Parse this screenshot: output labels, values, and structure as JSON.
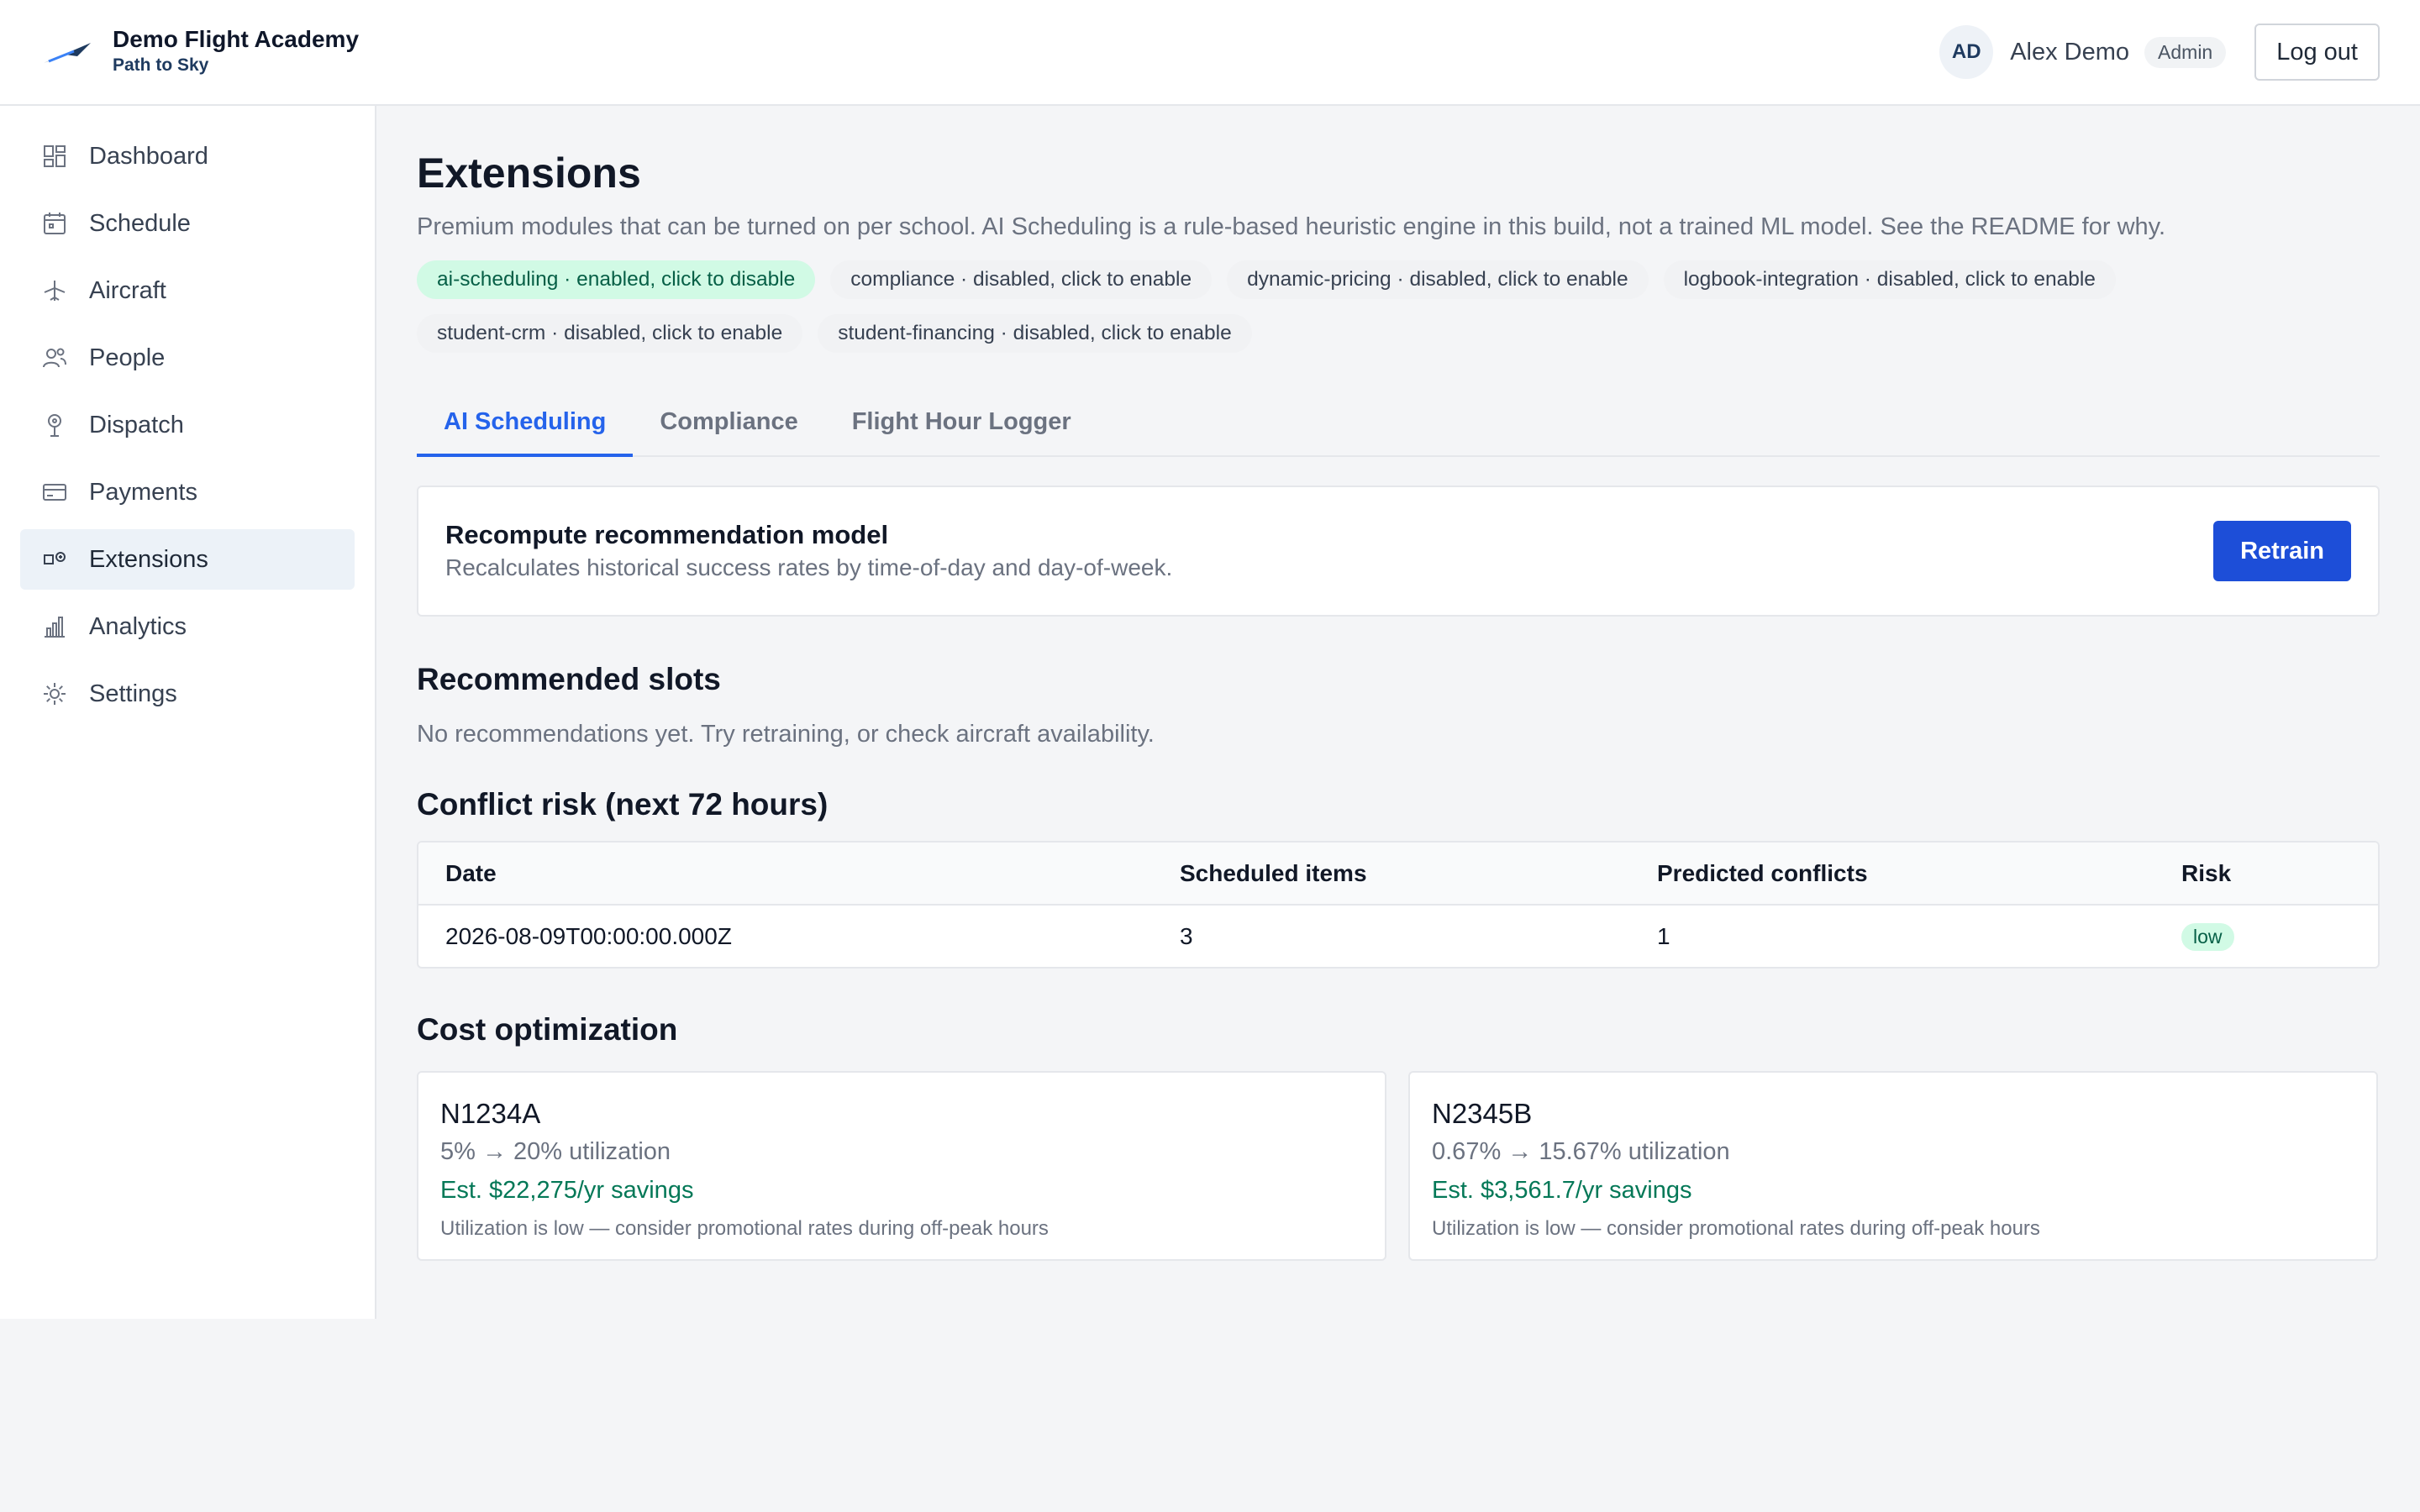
{
  "brand": {
    "name": "Demo Flight Academy",
    "tagline": "Path to Sky"
  },
  "user": {
    "initials": "AD",
    "name": "Alex Demo",
    "role": "Admin",
    "logout_label": "Log out"
  },
  "sidebar": {
    "items": [
      {
        "label": "Dashboard",
        "icon": "dashboard-icon"
      },
      {
        "label": "Schedule",
        "icon": "calendar-icon"
      },
      {
        "label": "Aircraft",
        "icon": "airplane-icon"
      },
      {
        "label": "People",
        "icon": "people-icon"
      },
      {
        "label": "Dispatch",
        "icon": "dispatch-icon"
      },
      {
        "label": "Payments",
        "icon": "credit-card-icon"
      },
      {
        "label": "Extensions",
        "icon": "extensions-icon",
        "active": true
      },
      {
        "label": "Analytics",
        "icon": "bar-chart-icon"
      },
      {
        "label": "Settings",
        "icon": "gear-icon"
      }
    ]
  },
  "page": {
    "title": "Extensions",
    "description": "Premium modules that can be turned on per school. AI Scheduling is a rule-based heuristic engine in this build, not a trained ML model. See the README for why."
  },
  "chips": [
    {
      "label": "ai-scheduling · enabled, click to disable",
      "enabled": true
    },
    {
      "label": "compliance · disabled, click to enable",
      "enabled": false
    },
    {
      "label": "dynamic-pricing · disabled, click to enable",
      "enabled": false
    },
    {
      "label": "logbook-integration · disabled, click to enable",
      "enabled": false
    },
    {
      "label": "student-crm · disabled, click to enable",
      "enabled": false
    },
    {
      "label": "student-financing · disabled, click to enable",
      "enabled": false
    }
  ],
  "tabs": [
    {
      "label": "AI Scheduling",
      "active": true
    },
    {
      "label": "Compliance",
      "active": false
    },
    {
      "label": "Flight Hour Logger",
      "active": false
    }
  ],
  "retrain": {
    "title": "Recompute recommendation model",
    "subtitle": "Recalculates historical success rates by time-of-day and day-of-week.",
    "button_label": "Retrain"
  },
  "recommended": {
    "title": "Recommended slots",
    "empty_text": "No recommendations yet. Try retraining, or check aircraft availability."
  },
  "conflict": {
    "title": "Conflict risk (next 72 hours)",
    "headers": [
      "Date",
      "Scheduled items",
      "Predicted conflicts",
      "Risk"
    ],
    "rows": [
      {
        "date": "2026-08-09T00:00:00.000Z",
        "scheduled": "3",
        "conflicts": "1",
        "risk": "low"
      }
    ]
  },
  "cost": {
    "title": "Cost optimization",
    "cards": [
      {
        "tail": "N1234A",
        "utilization": "5% → 20% utilization",
        "savings": "Est. $22,275/yr savings",
        "advice": "Utilization is low — consider promotional rates during off-peak hours"
      },
      {
        "tail": "N2345B",
        "utilization": "0.67% → 15.67% utilization",
        "savings": "Est. $3,561.7/yr savings",
        "advice": "Utilization is low — consider promotional rates during off-peak hours"
      }
    ]
  },
  "colors": {
    "accent": "#2563eb",
    "primary_button": "#1d4ed8",
    "success_bg": "#d1fae5",
    "success_text": "#065f46",
    "savings_text": "#047857"
  }
}
